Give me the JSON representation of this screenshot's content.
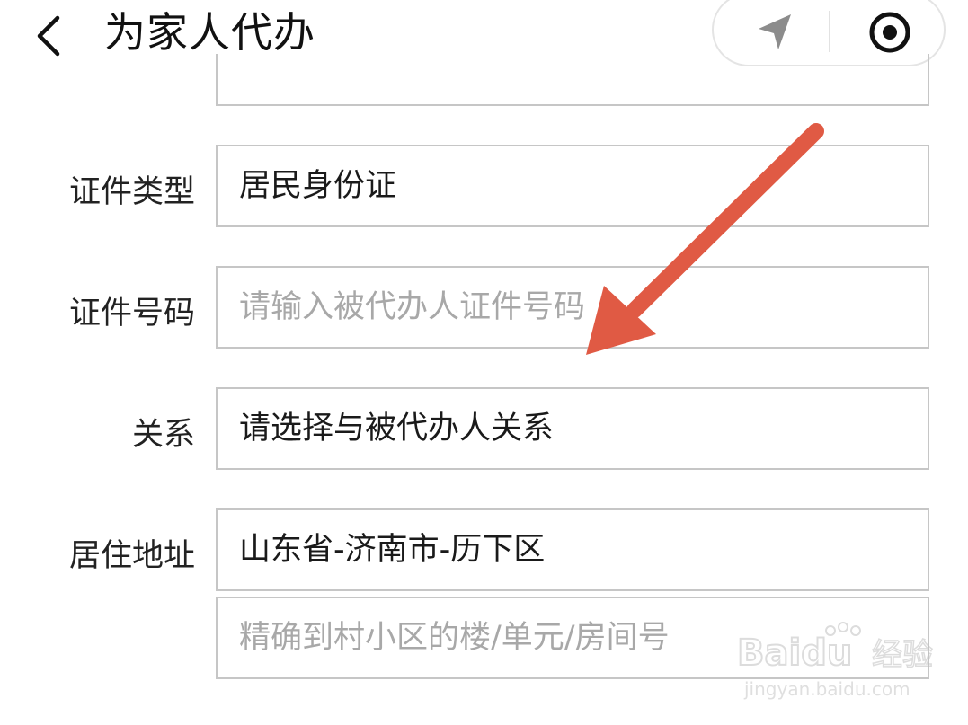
{
  "header": {
    "title": "为家人代办",
    "back_icon": "chevron-left-icon",
    "capsule": {
      "location_icon": "location-arrow-icon",
      "target_icon": "target-icon"
    }
  },
  "form": {
    "id_type": {
      "label": "证件类型",
      "value": "居民身份证"
    },
    "id_number": {
      "label": "证件号码",
      "placeholder": "请输入被代办人证件号码"
    },
    "relation": {
      "label": "关系",
      "value": "请选择与被代办人关系"
    },
    "address": {
      "label": "居住地址",
      "region_value": "山东省-济南市-历下区",
      "detail_placeholder": "精确到村小区的楼/单元/房间号"
    }
  },
  "annotation": {
    "color": "#e05a44"
  },
  "watermark": {
    "brand": "Baidu",
    "brand_cn": "经验",
    "url": "jingyan.baidu.com"
  }
}
